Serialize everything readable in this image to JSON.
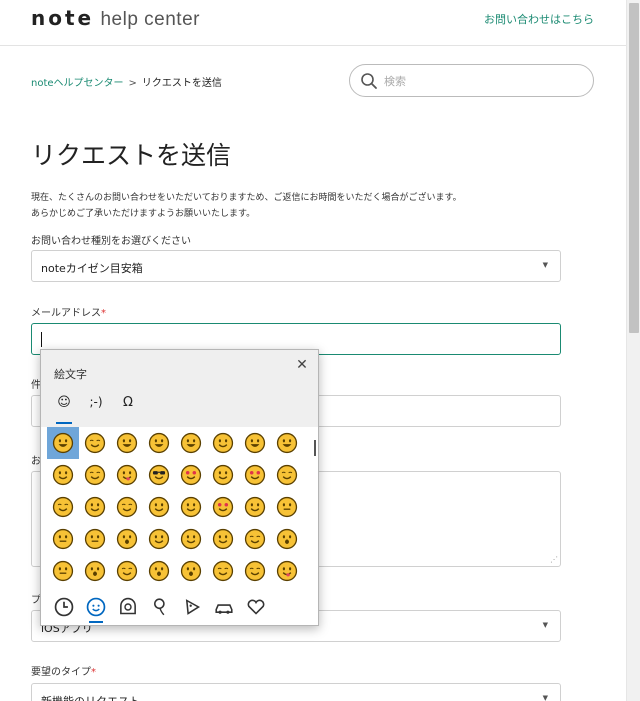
{
  "header": {
    "logo_brand": "note",
    "logo_sub": "help center",
    "contact_link": "お問い合わせはこちら"
  },
  "breadcrumb": {
    "home": "noteヘルプセンター",
    "separator": ">",
    "current": "リクエストを送信"
  },
  "search": {
    "placeholder": "検索"
  },
  "page_title": "リクエストを送信",
  "notice": {
    "line1": "現在、たくさんのお問い合わせをいただいておりますため、ご返信にお時間をいただく場合がございます。",
    "line2": "あらかじめご了承いただけますようお願いいたします。"
  },
  "form": {
    "inquiry_type_label": "お問い合わせ種別をお選びください",
    "inquiry_type_value": "noteカイゼン目安箱",
    "email_label": "メールアドレス",
    "required_mark": "*",
    "subject_label_clip": "件",
    "description_label_clip": "お",
    "platform_label_clip": "プ",
    "platform_value": "iOSアプリ",
    "request_type_label": "要望のタイプ",
    "request_type_value": "新機能のリクエスト"
  },
  "emoji_panel": {
    "title": "絵文字",
    "close": "✕",
    "tabs": [
      "☺",
      ";-)",
      "Ω"
    ],
    "active_tab": 0,
    "selected_emoji_index": 0,
    "emoji_rows": [
      [
        "grin",
        "grimace",
        "joy",
        "rofl",
        "smiley",
        "smile",
        "sweat-smile",
        "laughing"
      ],
      [
        "wink",
        "blush",
        "yum",
        "sunglasses",
        "heart-eyes",
        "kiss",
        "hearts",
        "smile-plain"
      ],
      [
        "relaxed",
        "hug",
        "blush2",
        "slight-smile",
        "hug2",
        "star-eyes",
        "think",
        "neutral2"
      ],
      [
        "neutral",
        "expressionless",
        "no-mouth",
        "eye-roll",
        "smirk",
        "persevere",
        "disappointed-relieved",
        "open-mouth"
      ],
      [
        "zipper",
        "hushed",
        "sleepy",
        "tired",
        "yawn",
        "sleeping",
        "relieved",
        "tongue"
      ]
    ],
    "categories": [
      "clock-icon",
      "smiley-icon",
      "people-icon",
      "balloon-icon",
      "pizza-icon",
      "car-icon",
      "heart-icon"
    ],
    "active_category": 1
  },
  "colors": {
    "accent": "#1a8a72",
    "emoji_face": "#f7c236",
    "emoji_outline": "#5a4000",
    "selection": "#6fa6d9"
  }
}
